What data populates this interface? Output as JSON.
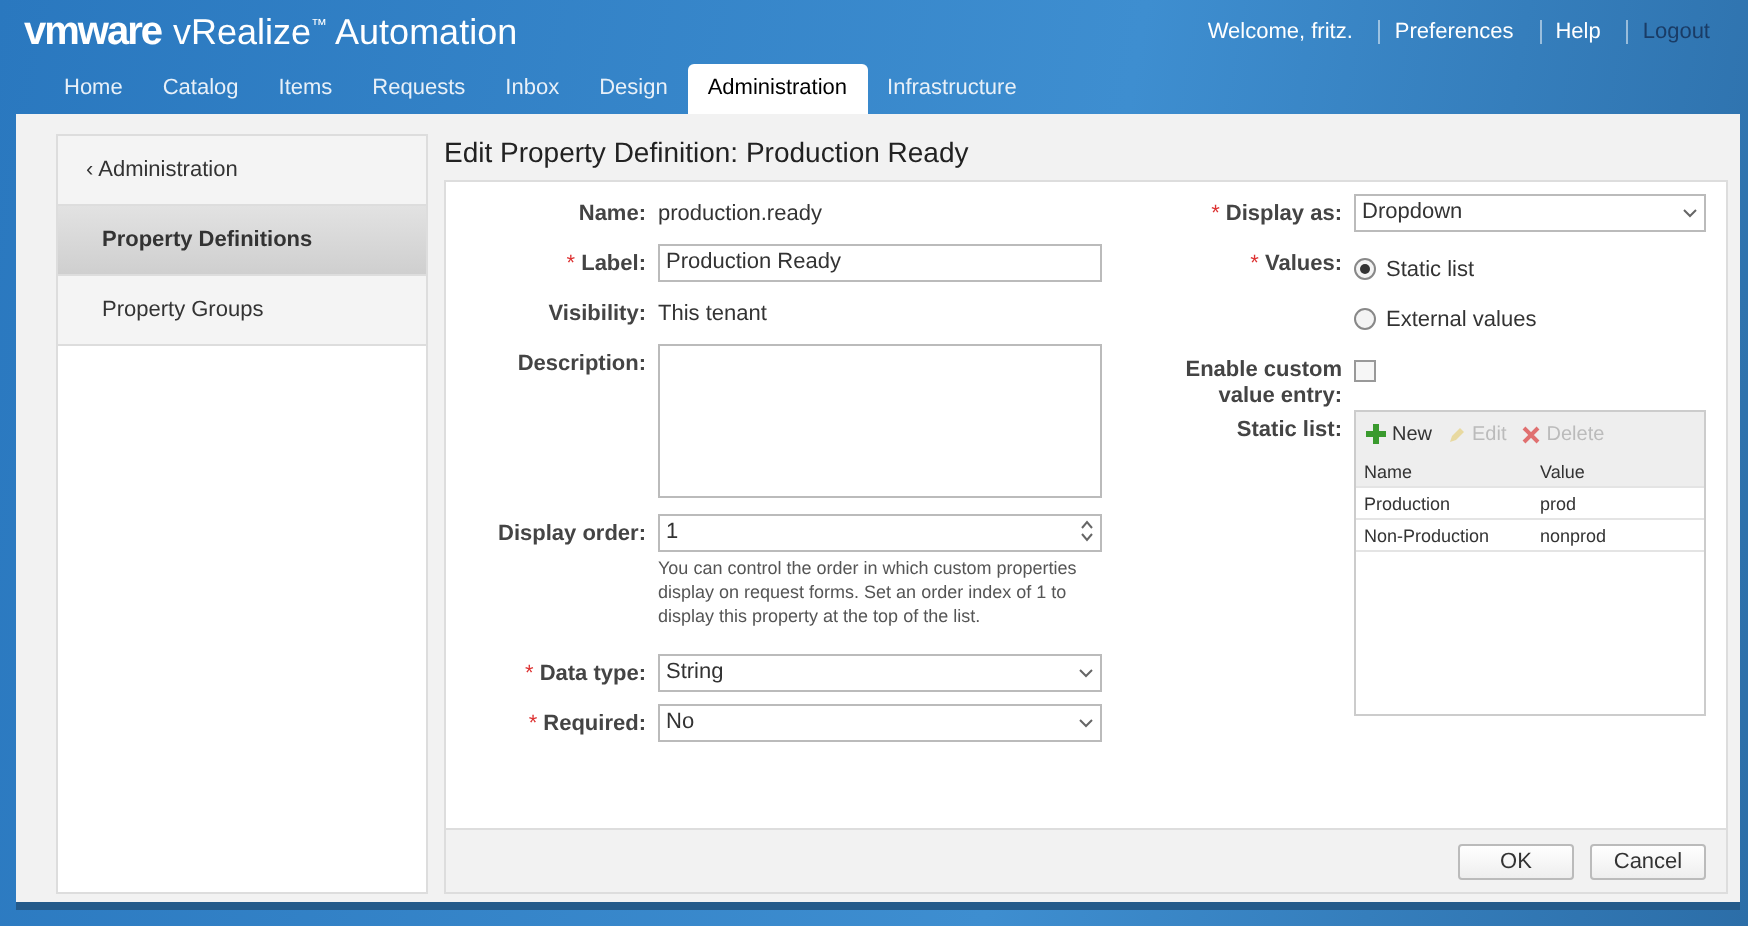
{
  "header": {
    "logo": "vmware",
    "product": "vRealize$^{™}$ Automation",
    "user_links": [
      "Welcome, fritz.",
      "Preferences",
      "Help",
      "Logout"
    ]
  },
  "tabs": [
    {
      "label": "Home",
      "selected": false
    },
    {
      "label": "Catalog",
      "selected": false
    },
    {
      "label": "Items",
      "selected": false
    },
    {
      "label": "Requests",
      "selected": false
    },
    {
      "label": "Inbox",
      "selected": false
    },
    {
      "label": "Design",
      "selected": false
    },
    {
      "label": "Administration",
      "selected": true
    },
    {
      "label": "Infrastructure",
      "selected": false
    }
  ],
  "sidebar": {
    "back": {
      "icon": "‹",
      "label": "Administration"
    },
    "items": [
      {
        "label": "Property Definitions",
        "selected": true
      },
      {
        "label": "Property Groups",
        "selected": false
      }
    ]
  },
  "page_title": "Edit Property Definition: Production Ready",
  "left_fields": [
    {
      "kind": "text",
      "label": "Name:",
      "value": "production.ready"
    },
    {
      "kind": "input",
      "label": "Label:",
      "required_mark": "*",
      "value": "Production Ready"
    },
    {
      "kind": "text",
      "label": "Visibility:",
      "value": "This tenant"
    },
    {
      "kind": "textarea",
      "label": "Description:"
    },
    {
      "kind": "number",
      "label": "Display order:",
      "value": "1",
      "help": "You can control the order in which custom properties display on request forms. Set an order index of 1 to display this property at the top of the list."
    },
    {
      "kind": "select",
      "label": "Data type:",
      "required_mark": "*",
      "value": "String"
    },
    {
      "kind": "select",
      "label": "Required:",
      "required_mark": "*",
      "value": "No"
    }
  ],
  "display_as": {
    "label": "Display as:",
    "required_mark": "*",
    "value": "Dropdown"
  },
  "values": {
    "label": "Values:",
    "required_mark": "*",
    "options": [
      {
        "label": "Static list",
        "selected": true
      },
      {
        "label": "External values",
        "selected": false
      }
    ]
  },
  "custom_entry": {
    "label": "Enable custom value entry:",
    "checked": false
  },
  "static_list": {
    "label": "Static list:",
    "actions": [
      {
        "kind": "add",
        "label": "New",
        "disabled": false
      },
      {
        "kind": "edit",
        "label": "Edit",
        "disabled": true
      },
      {
        "kind": "delete",
        "label": "Delete",
        "disabled": true
      }
    ],
    "columns": [
      "Name",
      "Value"
    ],
    "rows": [
      {
        "name": "Production",
        "value": "prod"
      },
      {
        "name": "Non-Production",
        "value": "nonprod"
      }
    ]
  },
  "buttons": [
    "OK",
    "Cancel"
  ]
}
